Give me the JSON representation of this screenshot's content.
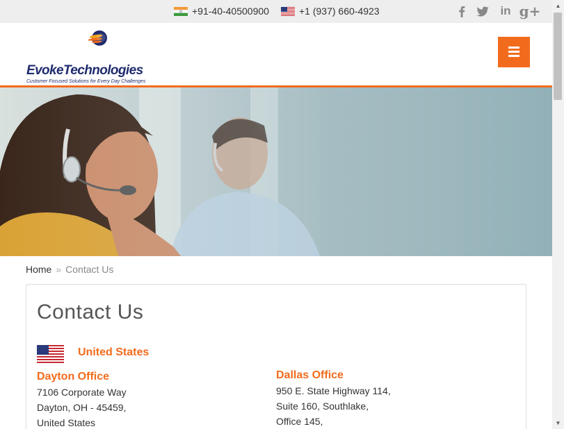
{
  "topbar": {
    "phone_india": "+91-40-40500900",
    "phone_us": "+1 (937) 660-4923",
    "social": [
      {
        "name": "facebook-icon",
        "glyph": "f"
      },
      {
        "name": "twitter-icon",
        "glyph": "t"
      },
      {
        "name": "linkedin-icon",
        "glyph": "in"
      },
      {
        "name": "google-plus-icon",
        "glyph": "g+"
      }
    ]
  },
  "brand": {
    "name": "EvokeTechnologies",
    "tagline": "Customer Focused Solutions for Every Day Challenges",
    "accent_color": "#f26b1d",
    "navy_color": "#1f2b6e"
  },
  "breadcrumb": {
    "home": "Home",
    "separator": "»",
    "current": "Contact Us"
  },
  "main": {
    "title": "Contact Us",
    "country": "United States",
    "offices": [
      {
        "title": "Dayton Office",
        "lines": [
          "7106 Corporate Way",
          "Dayton, OH - 45459,",
          "United States"
        ]
      },
      {
        "title": "Dallas Office",
        "lines": [
          "950 E. State Highway 114,",
          "Suite 160, Southlake,",
          "Office 145,"
        ]
      }
    ]
  }
}
